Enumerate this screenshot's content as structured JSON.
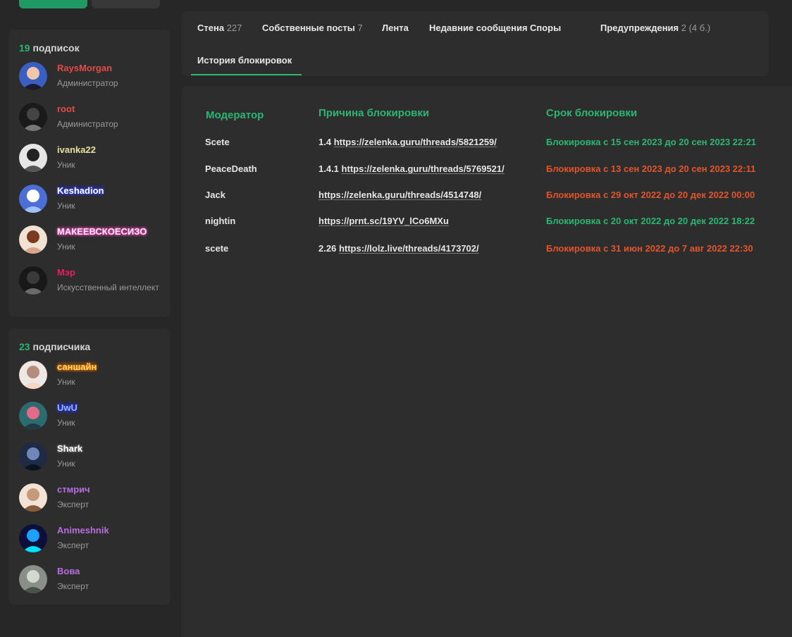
{
  "following": {
    "count": "19",
    "label": "подписок",
    "users": [
      {
        "name": "RaysMorgan",
        "role": "Администратор",
        "style": "c-red"
      },
      {
        "name": "root",
        "role": "Администратор",
        "style": "c-red"
      },
      {
        "name": "ivanka22",
        "role": "Уник",
        "style": "c-yellow"
      },
      {
        "name": "Keshadion",
        "role": "Уник",
        "style": "c-blue-glow"
      },
      {
        "name": "МАКЕЕВСКОЕСИЗО",
        "role": "Уник",
        "style": "c-pink-glow"
      },
      {
        "name": "Мэр",
        "role": "Искусственный интеллект",
        "style": "c-crimson"
      }
    ]
  },
  "followers": {
    "count": "23",
    "label": "подписчика",
    "users": [
      {
        "name": "саншайн",
        "role": "Уник",
        "style": "c-orange-glow"
      },
      {
        "name": "UwU",
        "role": "Уник",
        "style": "c-blue2-glow"
      },
      {
        "name": "Shark",
        "role": "Уник",
        "style": "c-white-glow"
      },
      {
        "name": "стмрич",
        "role": "Эксперт",
        "style": "c-purple"
      },
      {
        "name": "Animeshnik",
        "role": "Эксперт",
        "style": "c-purple"
      },
      {
        "name": "Вова",
        "role": "Эксперт",
        "style": "c-purple"
      }
    ]
  },
  "tabs": [
    {
      "label": "Стена",
      "count": "227"
    },
    {
      "label": "Собственные посты",
      "count": "7"
    },
    {
      "label": "Лента",
      "count": ""
    },
    {
      "label": "Недавние сообщения",
      "count": ""
    },
    {
      "label": "Споры",
      "count": ""
    },
    {
      "label": "Предупреждения",
      "count": "2 (4 б.)"
    },
    {
      "label": "История блокировок",
      "count": "",
      "active": true
    }
  ],
  "bans": {
    "headers": {
      "moderator": "Модератор",
      "reason": "Причина блокировки",
      "term": "Срок блокировки"
    },
    "rows": [
      {
        "moderator": "Scete",
        "reason_prefix": "1.4",
        "reason_link": "https://zelenka.guru/threads/5821259/",
        "term": "Блокировка с 15 сен 2023 до 20 сен 2023 22:21",
        "status": "green"
      },
      {
        "moderator": "PeaceDeath",
        "reason_prefix": "1.4.1",
        "reason_link": "https://zelenka.guru/threads/5769521/",
        "term": "Блокировка с 13 сен 2023 до 20 сен 2023 22:11",
        "status": "red"
      },
      {
        "moderator": "Jack",
        "reason_prefix": "",
        "reason_link": "https://zelenka.guru/threads/4514748/",
        "term": "Блокировка с 29 окт 2022 до 20 дек 2022 00:00",
        "status": "red"
      },
      {
        "moderator": "nightin",
        "reason_prefix": "",
        "reason_link": "https://prnt.sc/19YV_lCo6MXu",
        "term": "Блокировка с 20 окт 2022 до 20 дек 2022 18:22",
        "status": "green"
      },
      {
        "moderator": "scete",
        "reason_prefix": "2.26",
        "reason_link": "https://lolz.live/threads/4173702/",
        "term": "Блокировка с 31 июн 2022 до 7 авг 2022 22:30",
        "status": "red"
      }
    ]
  },
  "colors": {
    "accent": "#2bb673",
    "status_green": "#2bb673",
    "status_red": "#e0552c",
    "admin_red": "#e34a48"
  }
}
